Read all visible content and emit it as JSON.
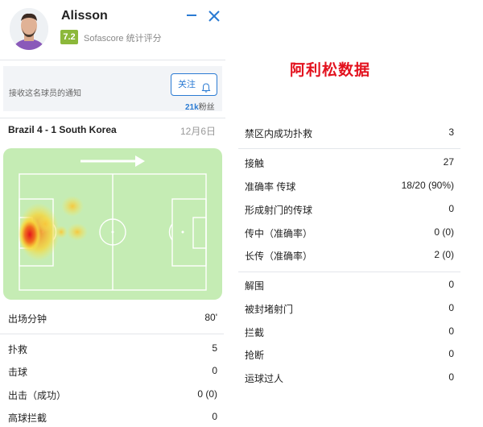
{
  "player": {
    "name": "Alisson",
    "rating": "7.2",
    "rating_source": "Sofascore 统计评分"
  },
  "follow": {
    "prompt": "接收这名球员的通知",
    "button_label": "关注",
    "fans_count": "21k",
    "fans_label": "粉丝"
  },
  "match": {
    "title": "Brazil 4 - 1 South Korea",
    "date": "12月6日"
  },
  "page_title": "阿利松数据",
  "left_stats": [
    {
      "label": "出场分钟",
      "value": "80'"
    },
    {
      "label": "扑救",
      "value": "5"
    },
    {
      "label": "击球",
      "value": "0"
    },
    {
      "label": "出击（成功）",
      "value": "0 (0)"
    },
    {
      "label": "高球拦截",
      "value": "0"
    }
  ],
  "right_stats": [
    {
      "label": "禁区内成功扑救",
      "value": "3"
    },
    {
      "label": "接触",
      "value": "27"
    },
    {
      "label": "准确率 传球",
      "value": "18/20 (90%)"
    },
    {
      "label": "形成射门的传球",
      "value": "0"
    },
    {
      "label": "传中（准确率）",
      "value": "0 (0)"
    },
    {
      "label": "长传（准确率）",
      "value": "2 (0)"
    },
    {
      "label": "解围",
      "value": "0"
    },
    {
      "label": "被封堵射门",
      "value": "0"
    },
    {
      "label": "拦截",
      "value": "0"
    },
    {
      "label": "抢断",
      "value": "0"
    },
    {
      "label": "运球过人",
      "value": "0"
    }
  ],
  "colors": {
    "accent": "#2b7bd3",
    "rating": "#8cb83a",
    "title_red": "#e3121e",
    "pitch": "#c5ecb4"
  },
  "icons": [
    "minimize-icon",
    "close-icon",
    "bell-icon",
    "attack-direction-arrow-icon"
  ]
}
